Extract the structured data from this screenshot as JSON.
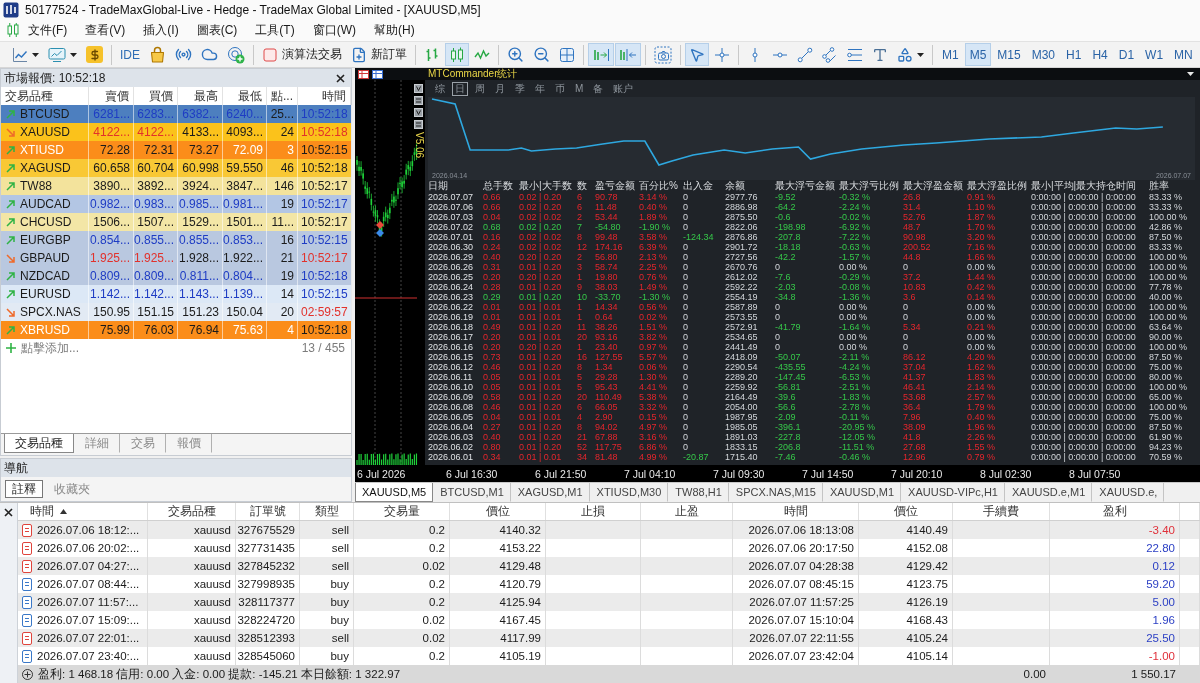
{
  "window": {
    "title": "50177524 - TradeMaxGlobal-Live - Hedge - TradeMax Global Limited - [XAUUSD,M5]"
  },
  "menu": [
    "文件(F)",
    "查看(V)",
    "插入(I)",
    "圖表(C)",
    "工具(T)",
    "窗口(W)",
    "幫助(H)"
  ],
  "toolbar": [
    {
      "kind": "chart-style-menu",
      "selected": false
    },
    {
      "kind": "indicator-menu",
      "selected": false
    },
    {
      "kind": "dollar",
      "selected": false
    },
    {
      "kind": "separator"
    },
    {
      "kind": "ide",
      "label": "IDE",
      "selected": false
    },
    {
      "kind": "market",
      "selected": false
    },
    {
      "kind": "signals",
      "selected": false
    },
    {
      "kind": "cloud",
      "selected": false
    },
    {
      "kind": "vps",
      "selected": false
    },
    {
      "kind": "separator"
    },
    {
      "kind": "algo-trading",
      "label": "演算法交易",
      "selected": false
    },
    {
      "kind": "new-order",
      "label": "新訂單",
      "selected": false
    },
    {
      "kind": "separator"
    },
    {
      "kind": "bar-chart",
      "selected": false
    },
    {
      "kind": "candle-chart",
      "selected": true
    },
    {
      "kind": "line-chart",
      "selected": false
    },
    {
      "kind": "separator"
    },
    {
      "kind": "zoom-in",
      "selected": false
    },
    {
      "kind": "zoom-out",
      "selected": false
    },
    {
      "kind": "tile",
      "selected": false
    },
    {
      "kind": "separator"
    },
    {
      "kind": "auto-scroll",
      "selected": true
    },
    {
      "kind": "chart-shift",
      "selected": true
    },
    {
      "kind": "separator"
    },
    {
      "kind": "screenshot",
      "selected": false
    },
    {
      "kind": "separator"
    },
    {
      "kind": "cursor",
      "selected": true
    },
    {
      "kind": "crosshair",
      "selected": false
    },
    {
      "kind": "separator"
    },
    {
      "kind": "vertical-line",
      "selected": false
    },
    {
      "kind": "horizontal-line",
      "selected": false
    },
    {
      "kind": "trend-line",
      "selected": false
    },
    {
      "kind": "channel",
      "selected": false
    },
    {
      "kind": "fibonacci",
      "selected": false
    },
    {
      "kind": "text",
      "selected": false
    },
    {
      "kind": "shapes-menu",
      "selected": false
    },
    {
      "kind": "separator"
    }
  ],
  "timeframes": [
    {
      "label": "M1",
      "selected": false
    },
    {
      "label": "M5",
      "selected": true
    },
    {
      "label": "M15",
      "selected": false
    },
    {
      "label": "M30",
      "selected": false
    },
    {
      "label": "H1",
      "selected": false
    },
    {
      "label": "H4",
      "selected": false
    },
    {
      "label": "D1",
      "selected": false
    },
    {
      "label": "W1",
      "selected": false
    },
    {
      "label": "MN",
      "selected": false
    }
  ],
  "market_watch": {
    "title": "市場報價: 10:52:18",
    "columns": [
      "交易品種",
      "賣價",
      "買價",
      "最高",
      "最低",
      "點...",
      "時間"
    ],
    "rows": [
      {
        "symbol": "BTCUSD",
        "bid": "6281...",
        "ask": "6283...",
        "high": "6382...",
        "low": "6240...",
        "spread": "25...",
        "time": "10:52:18",
        "kind": "rising",
        "price_up": true,
        "price_down": false,
        "time_up": true,
        "time_down": false,
        "inverted": false,
        "color": "#4d7fbf"
      },
      {
        "symbol": "XAUUSD",
        "bid": "4122...",
        "ask": "4122...",
        "high": "4133...",
        "low": "4093...",
        "spread": "24",
        "time": "10:52:18",
        "kind": "falling",
        "price_up": false,
        "price_down": true,
        "time_up": false,
        "time_down": true,
        "inverted": false,
        "color": "#fbc21b"
      },
      {
        "symbol": "XTIUSD",
        "bid": "72.28",
        "ask": "72.31",
        "high": "73.27",
        "low": "72.09",
        "spread": "3",
        "time": "10:52:15",
        "kind": "rising",
        "price_up": false,
        "price_down": false,
        "time_up": false,
        "time_down": false,
        "inverted": true,
        "color": "#fb8d1a"
      },
      {
        "symbol": "XAGUSD",
        "bid": "60.658",
        "ask": "60.704",
        "high": "60.998",
        "low": "59.550",
        "spread": "46",
        "time": "10:52:18",
        "kind": "rising",
        "price_up": false,
        "price_down": false,
        "time_up": false,
        "time_down": false,
        "inverted": false,
        "color": "#f9c835"
      },
      {
        "symbol": "TW88",
        "bid": "3890...",
        "ask": "3892...",
        "high": "3924...",
        "low": "3847...",
        "spread": "146",
        "time": "10:52:17",
        "kind": "rising",
        "price_up": false,
        "price_down": false,
        "time_up": false,
        "time_down": false,
        "inverted": false,
        "color": "#f3e39c"
      },
      {
        "symbol": "AUDCAD",
        "bid": "0.982...",
        "ask": "0.983...",
        "high": "0.985...",
        "low": "0.981...",
        "spread": "19",
        "time": "10:52:17",
        "kind": "rising",
        "price_up": true,
        "price_down": false,
        "time_up": true,
        "time_down": false,
        "inverted": false,
        "color": "#b3c6e4"
      },
      {
        "symbol": "CHCUSD",
        "bid": "1506...",
        "ask": "1507...",
        "high": "1529...",
        "low": "1501...",
        "spread": "11...",
        "time": "10:52:17",
        "kind": "rising",
        "price_up": false,
        "price_down": false,
        "time_up": false,
        "time_down": false,
        "inverted": false,
        "color": "#f3e6a6"
      },
      {
        "symbol": "EURGBP",
        "bid": "0.854...",
        "ask": "0.855...",
        "high": "0.855...",
        "low": "0.853...",
        "spread": "16",
        "time": "10:52:15",
        "kind": "rising",
        "price_up": true,
        "price_down": false,
        "time_up": true,
        "time_down": false,
        "inverted": false,
        "color": "#b9c8e0"
      },
      {
        "symbol": "GBPAUD",
        "bid": "1.925...",
        "ask": "1.925...",
        "high": "1.928...",
        "low": "1.922...",
        "spread": "21",
        "time": "10:52:17",
        "kind": "falling",
        "price_up": false,
        "price_down": true,
        "time_up": false,
        "time_down": true,
        "inverted": false,
        "color": "#b9c8e0"
      },
      {
        "symbol": "NZDCAD",
        "bid": "0.809...",
        "ask": "0.809...",
        "high": "0.811...",
        "low": "0.804...",
        "spread": "19",
        "time": "10:52:18",
        "kind": "rising",
        "price_up": true,
        "price_down": false,
        "time_up": true,
        "time_down": false,
        "inverted": false,
        "color": "#b9c8e0"
      },
      {
        "symbol": "EURUSD",
        "bid": "1.142...",
        "ask": "1.142...",
        "high": "1.143...",
        "low": "1.139...",
        "spread": "14",
        "time": "10:52:15",
        "kind": "rising",
        "price_up": true,
        "price_down": false,
        "time_up": true,
        "time_down": false,
        "inverted": false,
        "color": "#dce8f6"
      },
      {
        "symbol": "SPCX.NAS",
        "bid": "150.95",
        "ask": "151.15",
        "high": "151.23",
        "low": "150.04",
        "spread": "20",
        "time": "02:59:57",
        "kind": "falling",
        "price_up": false,
        "price_down": false,
        "time_up": false,
        "time_down": true,
        "inverted": false,
        "color": "#e2eaf4"
      },
      {
        "symbol": "XBRUSD",
        "bid": "75.99",
        "ask": "76.03",
        "high": "76.94",
        "low": "75.63",
        "spread": "4",
        "time": "10:52:18",
        "kind": "rising",
        "price_up": false,
        "price_down": false,
        "time_up": false,
        "time_down": false,
        "inverted": true,
        "color": "#fb8d1a"
      }
    ],
    "add_hint": "點擊添加...",
    "count": "13 / 455",
    "tabs": [
      {
        "label": "交易品種",
        "selected": true
      },
      {
        "label": "詳細",
        "selected": false
      },
      {
        "label": "交易",
        "selected": false
      },
      {
        "label": "報價",
        "selected": false
      }
    ]
  },
  "navigator": {
    "title": "導航",
    "tabs": [
      {
        "label": "註釋",
        "selected": true
      },
      {
        "label": "收藏夾",
        "selected": false
      }
    ]
  },
  "chart": {
    "title": "MTCommander统计",
    "version": "V5.06",
    "periods": [
      {
        "label": "综",
        "selected": false
      },
      {
        "label": "日",
        "selected": true
      },
      {
        "label": "周",
        "selected": false
      },
      {
        "label": "月",
        "selected": false
      },
      {
        "label": "季",
        "selected": false
      },
      {
        "label": "年",
        "selected": false
      },
      {
        "label": "币",
        "selected": false
      },
      {
        "label": "M",
        "selected": false
      },
      {
        "label": "备",
        "selected": false
      },
      {
        "label": "账户",
        "selected": false
      }
    ],
    "curve_start": "2026.04.14",
    "curve_end": "2026.07.07",
    "stats_columns": [
      "日期",
      "总手数",
      "最小|大手数",
      "数",
      "盈亏金额",
      "百分比%",
      "出入金",
      "余额",
      "最大浮亏金额",
      "最大浮亏比例",
      "最大浮盈金额",
      "最大浮盈比例",
      "最小|平均|最大持仓时间",
      "胜率"
    ],
    "stats_rows": [
      {
        "date": "2026.07.07",
        "lots": "0.66",
        "min_max": "0.02 | 0.20",
        "trades": "6",
        "pnl": "90.78",
        "pct": "3.14 %",
        "cash_flow": "0",
        "balance": "2977.76",
        "max_float_loss": "-9.52",
        "max_float_loss_pct": "-0.32 %",
        "max_float_profit": "26.8",
        "max_float_profit_pct": "0.91 %",
        "hold_times": "0:00:00 | 0:00:00 | 0:00:00",
        "win_rate": "83.33 %",
        "kind": "gain",
        "floating": true,
        "cash_moved": false
      },
      {
        "date": "2026.07.06",
        "lots": "0.66",
        "min_max": "0.02 | 0.20",
        "trades": "6",
        "pnl": "11.48",
        "pct": "0.40 %",
        "cash_flow": "0",
        "balance": "2886.98",
        "max_float_loss": "-64.2",
        "max_float_loss_pct": "-2.24 %",
        "max_float_profit": "31.4",
        "max_float_profit_pct": "1.10 %",
        "hold_times": "0:00:00 | 0:00:00 | 0:00:00",
        "win_rate": "33.33 %",
        "kind": "gain",
        "floating": true,
        "cash_moved": false
      },
      {
        "date": "2026.07.03",
        "lots": "0.04",
        "min_max": "0.02 | 0.02",
        "trades": "2",
        "pnl": "53.44",
        "pct": "1.89 %",
        "cash_flow": "0",
        "balance": "2875.50",
        "max_float_loss": "-0.6",
        "max_float_loss_pct": "-0.02 %",
        "max_float_profit": "52.76",
        "max_float_profit_pct": "1.87 %",
        "hold_times": "0:00:00 | 0:00:00 | 0:00:00",
        "win_rate": "100.00 %",
        "kind": "gain",
        "floating": true,
        "cash_moved": false
      },
      {
        "date": "2026.07.02",
        "lots": "0.68",
        "min_max": "0.02 | 0.20",
        "trades": "7",
        "pnl": "-54.80",
        "pct": "-1.90 %",
        "cash_flow": "0",
        "balance": "2822.06",
        "max_float_loss": "-198.98",
        "max_float_loss_pct": "-6.92 %",
        "max_float_profit": "48.7",
        "max_float_profit_pct": "1.70 %",
        "hold_times": "0:00:00 | 0:00:00 | 0:00:00",
        "win_rate": "42.86 %",
        "kind": "loss",
        "floating": true,
        "cash_moved": false
      },
      {
        "date": "2026.07.01",
        "lots": "0.16",
        "min_max": "0.02 | 0.02",
        "trades": "8",
        "pnl": "99.48",
        "pct": "3.58 %",
        "cash_flow": "-124.34",
        "balance": "2876.86",
        "max_float_loss": "-207.8",
        "max_float_loss_pct": "-7.22 %",
        "max_float_profit": "90.98",
        "max_float_profit_pct": "3.20 %",
        "hold_times": "0:00:00 | 0:00:00 | 0:00:00",
        "win_rate": "87.50 %",
        "kind": "gain",
        "floating": true,
        "cash_moved": true
      },
      {
        "date": "2026.06.30",
        "lots": "0.24",
        "min_max": "0.02 | 0.02",
        "trades": "12",
        "pnl": "174.16",
        "pct": "6.39 %",
        "cash_flow": "0",
        "balance": "2901.72",
        "max_float_loss": "-18.18",
        "max_float_loss_pct": "-0.63 %",
        "max_float_profit": "200.52",
        "max_float_profit_pct": "7.16 %",
        "hold_times": "0:00:00 | 0:00:00 | 0:00:00",
        "win_rate": "83.33 %",
        "kind": "gain",
        "floating": true,
        "cash_moved": false
      },
      {
        "date": "2026.06.29",
        "lots": "0.40",
        "min_max": "0.20 | 0.20",
        "trades": "2",
        "pnl": "56.80",
        "pct": "2.13 %",
        "cash_flow": "0",
        "balance": "2727.56",
        "max_float_loss": "-42.2",
        "max_float_loss_pct": "-1.57 %",
        "max_float_profit": "44.8",
        "max_float_profit_pct": "1.66 %",
        "hold_times": "0:00:00 | 0:00:00 | 0:00:00",
        "win_rate": "100.00 %",
        "kind": "gain",
        "floating": true,
        "cash_moved": false
      },
      {
        "date": "2026.06.26",
        "lots": "0.31",
        "min_max": "0.01 | 0.20",
        "trades": "3",
        "pnl": "58.74",
        "pct": "2.25 %",
        "cash_flow": "0",
        "balance": "2670.76",
        "max_float_loss": "0",
        "max_float_loss_pct": "0.00 %",
        "max_float_profit": "0",
        "max_float_profit_pct": "0.00 %",
        "hold_times": "0:00:00 | 0:00:00 | 0:00:00",
        "win_rate": "100.00 %",
        "kind": "gain",
        "floating": false,
        "cash_moved": false
      },
      {
        "date": "2026.06.25",
        "lots": "0.20",
        "min_max": "0.20 | 0.20",
        "trades": "1",
        "pnl": "19.80",
        "pct": "0.76 %",
        "cash_flow": "0",
        "balance": "2612.02",
        "max_float_loss": "-7.6",
        "max_float_loss_pct": "-0.29 %",
        "max_float_profit": "37.2",
        "max_float_profit_pct": "1.44 %",
        "hold_times": "0:00:00 | 0:00:00 | 0:00:00",
        "win_rate": "100.00 %",
        "kind": "gain",
        "floating": true,
        "cash_moved": false
      },
      {
        "date": "2026.06.24",
        "lots": "0.28",
        "min_max": "0.01 | 0.20",
        "trades": "9",
        "pnl": "38.03",
        "pct": "1.49 %",
        "cash_flow": "0",
        "balance": "2592.22",
        "max_float_loss": "-2.03",
        "max_float_loss_pct": "-0.08 %",
        "max_float_profit": "10.83",
        "max_float_profit_pct": "0.42 %",
        "hold_times": "0:00:00 | 0:00:00 | 0:00:00",
        "win_rate": "77.78 %",
        "kind": "gain",
        "floating": true,
        "cash_moved": false
      },
      {
        "date": "2026.06.23",
        "lots": "0.29",
        "min_max": "0.01 | 0.20",
        "trades": "10",
        "pnl": "-33.70",
        "pct": "-1.30 %",
        "cash_flow": "0",
        "balance": "2554.19",
        "max_float_loss": "-34.8",
        "max_float_loss_pct": "-1.36 %",
        "max_float_profit": "3.6",
        "max_float_profit_pct": "0.14 %",
        "hold_times": "0:00:00 | 0:00:00 | 0:00:00",
        "win_rate": "40.00 %",
        "kind": "loss",
        "floating": true,
        "cash_moved": false
      },
      {
        "date": "2026.06.22",
        "lots": "0.01",
        "min_max": "0.01 | 0.01",
        "trades": "1",
        "pnl": "14.34",
        "pct": "0.56 %",
        "cash_flow": "0",
        "balance": "2587.89",
        "max_float_loss": "0",
        "max_float_loss_pct": "0.00 %",
        "max_float_profit": "0",
        "max_float_profit_pct": "0.00 %",
        "hold_times": "0:00:00 | 0:00:00 | 0:00:00",
        "win_rate": "100.00 %",
        "kind": "gain",
        "floating": false,
        "cash_moved": false
      },
      {
        "date": "2026.06.19",
        "lots": "0.01",
        "min_max": "0.01 | 0.01",
        "trades": "1",
        "pnl": "0.64",
        "pct": "0.02 %",
        "cash_flow": "0",
        "balance": "2573.55",
        "max_float_loss": "0",
        "max_float_loss_pct": "0.00 %",
        "max_float_profit": "0",
        "max_float_profit_pct": "0.00 %",
        "hold_times": "0:00:00 | 0:00:00 | 0:00:00",
        "win_rate": "100.00 %",
        "kind": "gain",
        "floating": false,
        "cash_moved": false
      },
      {
        "date": "2026.06.18",
        "lots": "0.49",
        "min_max": "0.01 | 0.20",
        "trades": "11",
        "pnl": "38.26",
        "pct": "1.51 %",
        "cash_flow": "0",
        "balance": "2572.91",
        "max_float_loss": "-41.79",
        "max_float_loss_pct": "-1.64 %",
        "max_float_profit": "5.34",
        "max_float_profit_pct": "0.21 %",
        "hold_times": "0:00:00 | 0:00:00 | 0:00:00",
        "win_rate": "63.64 %",
        "kind": "gain",
        "floating": true,
        "cash_moved": false
      },
      {
        "date": "2026.06.17",
        "lots": "0.20",
        "min_max": "0.01 | 0.01",
        "trades": "20",
        "pnl": "93.16",
        "pct": "3.82 %",
        "cash_flow": "0",
        "balance": "2534.65",
        "max_float_loss": "0",
        "max_float_loss_pct": "0.00 %",
        "max_float_profit": "0",
        "max_float_profit_pct": "0.00 %",
        "hold_times": "0:00:00 | 0:00:00 | 0:00:00",
        "win_rate": "90.00 %",
        "kind": "gain",
        "floating": false,
        "cash_moved": false
      },
      {
        "date": "2026.06.16",
        "lots": "0.20",
        "min_max": "0.20 | 0.20",
        "trades": "1",
        "pnl": "23.40",
        "pct": "0.97 %",
        "cash_flow": "0",
        "balance": "2441.49",
        "max_float_loss": "0",
        "max_float_loss_pct": "0.00 %",
        "max_float_profit": "0",
        "max_float_profit_pct": "0.00 %",
        "hold_times": "0:00:00 | 0:00:00 | 0:00:00",
        "win_rate": "100.00 %",
        "kind": "gain",
        "floating": false,
        "cash_moved": false
      },
      {
        "date": "2026.06.15",
        "lots": "0.73",
        "min_max": "0.01 | 0.20",
        "trades": "16",
        "pnl": "127.55",
        "pct": "5.57 %",
        "cash_flow": "0",
        "balance": "2418.09",
        "max_float_loss": "-50.07",
        "max_float_loss_pct": "-2.11 %",
        "max_float_profit": "86.12",
        "max_float_profit_pct": "4.20 %",
        "hold_times": "0:00:00 | 0:00:00 | 0:00:00",
        "win_rate": "87.50 %",
        "kind": "gain",
        "floating": true,
        "cash_moved": false
      },
      {
        "date": "2026.06.12",
        "lots": "0.46",
        "min_max": "0.01 | 0.20",
        "trades": "8",
        "pnl": "1.34",
        "pct": "0.06 %",
        "cash_flow": "0",
        "balance": "2290.54",
        "max_float_loss": "-435.55",
        "max_float_loss_pct": "-4.24 %",
        "max_float_profit": "37.04",
        "max_float_profit_pct": "1.62 %",
        "hold_times": "0:00:00 | 0:00:00 | 0:00:00",
        "win_rate": "75.00 %",
        "kind": "gain",
        "floating": true,
        "cash_moved": false
      },
      {
        "date": "2026.06.11",
        "lots": "0.05",
        "min_max": "0.01 | 0.01",
        "trades": "5",
        "pnl": "29.28",
        "pct": "1.30 %",
        "cash_flow": "0",
        "balance": "2289.20",
        "max_float_loss": "-147.45",
        "max_float_loss_pct": "-6.53 %",
        "max_float_profit": "41.37",
        "max_float_profit_pct": "1.83 %",
        "hold_times": "0:00:00 | 0:00:00 | 0:00:00",
        "win_rate": "80.00 %",
        "kind": "gain",
        "floating": true,
        "cash_moved": false
      },
      {
        "date": "2026.06.10",
        "lots": "0.05",
        "min_max": "0.01 | 0.01",
        "trades": "5",
        "pnl": "95.43",
        "pct": "4.41 %",
        "cash_flow": "0",
        "balance": "2259.92",
        "max_float_loss": "-56.81",
        "max_float_loss_pct": "-2.51 %",
        "max_float_profit": "46.41",
        "max_float_profit_pct": "2.14 %",
        "hold_times": "0:00:00 | 0:00:00 | 0:00:00",
        "win_rate": "100.00 %",
        "kind": "gain",
        "floating": true,
        "cash_moved": false
      },
      {
        "date": "2026.06.09",
        "lots": "0.58",
        "min_max": "0.01 | 0.20",
        "trades": "20",
        "pnl": "110.49",
        "pct": "5.38 %",
        "cash_flow": "0",
        "balance": "2164.49",
        "max_float_loss": "-39.6",
        "max_float_loss_pct": "-1.83 %",
        "max_float_profit": "53.68",
        "max_float_profit_pct": "2.57 %",
        "hold_times": "0:00:00 | 0:00:00 | 0:00:00",
        "win_rate": "65.00 %",
        "kind": "gain",
        "floating": true,
        "cash_moved": false
      },
      {
        "date": "2026.06.08",
        "lots": "0.46",
        "min_max": "0.01 | 0.20",
        "trades": "6",
        "pnl": "66.05",
        "pct": "3.32 %",
        "cash_flow": "0",
        "balance": "2054.00",
        "max_float_loss": "-56.6",
        "max_float_loss_pct": "-2.78 %",
        "max_float_profit": "36.4",
        "max_float_profit_pct": "1.79 %",
        "hold_times": "0:00:00 | 0:00:00 | 0:00:00",
        "win_rate": "100.00 %",
        "kind": "gain",
        "floating": true,
        "cash_moved": false
      },
      {
        "date": "2026.06.05",
        "lots": "0.04",
        "min_max": "0.01 | 0.01",
        "trades": "4",
        "pnl": "2.90",
        "pct": "0.15 %",
        "cash_flow": "0",
        "balance": "1987.95",
        "max_float_loss": "-2.09",
        "max_float_loss_pct": "-0.11 %",
        "max_float_profit": "7.96",
        "max_float_profit_pct": "0.40 %",
        "hold_times": "0:00:00 | 0:00:00 | 0:00:00",
        "win_rate": "75.00 %",
        "kind": "gain",
        "floating": true,
        "cash_moved": false
      },
      {
        "date": "2026.06.04",
        "lots": "0.27",
        "min_max": "0.01 | 0.20",
        "trades": "8",
        "pnl": "94.02",
        "pct": "4.97 %",
        "cash_flow": "0",
        "balance": "1985.05",
        "max_float_loss": "-396.1",
        "max_float_loss_pct": "-20.95 %",
        "max_float_profit": "38.09",
        "max_float_profit_pct": "1.96 %",
        "hold_times": "0:00:00 | 0:00:00 | 0:00:00",
        "win_rate": "87.50 %",
        "kind": "gain",
        "floating": true,
        "cash_moved": false
      },
      {
        "date": "2026.06.03",
        "lots": "0.40",
        "min_max": "0.01 | 0.20",
        "trades": "21",
        "pnl": "67.88",
        "pct": "3.16 %",
        "cash_flow": "0",
        "balance": "1891.03",
        "max_float_loss": "-227.8",
        "max_float_loss_pct": "-12.05 %",
        "max_float_profit": "41.8",
        "max_float_profit_pct": "2.26 %",
        "hold_times": "0:00:00 | 0:00:00 | 0:00:00",
        "win_rate": "61.90 %",
        "kind": "gain",
        "floating": true,
        "cash_moved": false
      },
      {
        "date": "2026.06.02",
        "lots": "0.80",
        "min_max": "0.01 | 0.20",
        "trades": "52",
        "pnl": "117.75",
        "pct": "6.86 %",
        "cash_flow": "0",
        "balance": "1833.15",
        "max_float_loss": "-206.8",
        "max_float_loss_pct": "-11.51 %",
        "max_float_profit": "27.68",
        "max_float_profit_pct": "1.55 %",
        "hold_times": "0:00:00 | 0:00:00 | 0:00:00",
        "win_rate": "94.23 %",
        "kind": "gain",
        "floating": true,
        "cash_moved": false
      },
      {
        "date": "2026.06.01",
        "lots": "0.34",
        "min_max": "0.01 | 0.01",
        "trades": "34",
        "pnl": "81.48",
        "pct": "4.99 %",
        "cash_flow": "-20.87",
        "balance": "1715.40",
        "max_float_loss": "-7.46",
        "max_float_loss_pct": "-0.46 %",
        "max_float_profit": "12.96",
        "max_float_profit_pct": "0.79 %",
        "hold_times": "0:00:00 | 0:00:00 | 0:00:00",
        "win_rate": "70.59 %",
        "kind": "gain",
        "floating": true,
        "cash_moved": true
      }
    ],
    "time_axis": [
      "6 Jul 2026",
      "6 Jul 16:30",
      "6 Jul 21:50",
      "7 Jul 04:10",
      "7 Jul 09:30",
      "7 Jul 14:50",
      "7 Jul 20:10",
      "8 Jul 02:30",
      "8 Jul 07:50"
    ],
    "tabs": [
      {
        "label": "XAUUSD,M5",
        "selected": true
      },
      {
        "label": "BTCUSD,M1",
        "selected": false
      },
      {
        "label": "XAGUSD,M1",
        "selected": false
      },
      {
        "label": "XTIUSD,M30",
        "selected": false
      },
      {
        "label": "TW88,H1",
        "selected": false
      },
      {
        "label": "SPCX.NAS,M15",
        "selected": false
      },
      {
        "label": "XAUUSD,M1",
        "selected": false
      },
      {
        "label": "XAUUSD-VIPc,H1",
        "selected": false
      },
      {
        "label": "XAUUSD.e,M1",
        "selected": false
      },
      {
        "label": "XAUUSD.e,",
        "selected": false
      }
    ]
  },
  "trades": {
    "columns": [
      {
        "label": "時間",
        "sorted": true
      },
      {
        "label": "交易品種",
        "sorted": false
      },
      {
        "label": "訂單號",
        "sorted": false
      },
      {
        "label": "類型",
        "sorted": false
      },
      {
        "label": "交易量",
        "sorted": false
      },
      {
        "label": "價位",
        "sorted": false
      },
      {
        "label": "止損",
        "sorted": false
      },
      {
        "label": "止盈",
        "sorted": false
      },
      {
        "label": "時間",
        "sorted": false
      },
      {
        "label": "價位",
        "sorted": false
      },
      {
        "label": "手續費",
        "sorted": false
      },
      {
        "label": "盈利",
        "sorted": false
      }
    ],
    "rows": [
      {
        "open_time": "2026.07.06 18:12:...",
        "symbol": "xauusd",
        "ticket": "327675529",
        "type": "sell",
        "volume": "0.2",
        "open_price": "4140.32",
        "close_time": "2026.07.06 18:13:08",
        "close_price": "4140.49",
        "profit": "-3.40",
        "kind": "sell",
        "loss": true
      },
      {
        "open_time": "2026.07.06 20:02:...",
        "symbol": "xauusd",
        "ticket": "327731435",
        "type": "sell",
        "volume": "0.2",
        "open_price": "4153.22",
        "close_time": "2026.07.06 20:17:50",
        "close_price": "4152.08",
        "profit": "22.80",
        "kind": "sell",
        "loss": false
      },
      {
        "open_time": "2026.07.07 04:27:...",
        "symbol": "xauusd",
        "ticket": "327845232",
        "type": "sell",
        "volume": "0.02",
        "open_price": "4129.48",
        "close_time": "2026.07.07 04:28:38",
        "close_price": "4129.42",
        "profit": "0.12",
        "kind": "sell",
        "loss": false
      },
      {
        "open_time": "2026.07.07 08:44:...",
        "symbol": "xauusd",
        "ticket": "327998935",
        "type": "buy",
        "volume": "0.2",
        "open_price": "4120.79",
        "close_time": "2026.07.07 08:45:15",
        "close_price": "4123.75",
        "profit": "59.20",
        "kind": "buy",
        "loss": false
      },
      {
        "open_time": "2026.07.07 11:57:...",
        "symbol": "xauusd",
        "ticket": "328117377",
        "type": "buy",
        "volume": "0.2",
        "open_price": "4125.94",
        "close_time": "2026.07.07 11:57:25",
        "close_price": "4126.19",
        "profit": "5.00",
        "kind": "buy",
        "loss": false
      },
      {
        "open_time": "2026.07.07 15:09:...",
        "symbol": "xauusd",
        "ticket": "328224720",
        "type": "buy",
        "volume": "0.02",
        "open_price": "4167.45",
        "close_time": "2026.07.07 15:10:04",
        "close_price": "4168.43",
        "profit": "1.96",
        "kind": "buy",
        "loss": false
      },
      {
        "open_time": "2026.07.07 22:01:...",
        "symbol": "xauusd",
        "ticket": "328512393",
        "type": "sell",
        "volume": "0.02",
        "open_price": "4117.99",
        "close_time": "2026.07.07 22:11:55",
        "close_price": "4105.24",
        "profit": "25.50",
        "kind": "sell",
        "loss": false
      },
      {
        "open_time": "2026.07.07 23:40:...",
        "symbol": "xauusd",
        "ticket": "328545060",
        "type": "buy",
        "volume": "0.2",
        "open_price": "4105.19",
        "close_time": "2026.07.07 23:42:04",
        "close_price": "4105.14",
        "profit": "-1.00",
        "kind": "buy",
        "loss": true
      }
    ],
    "summary": {
      "text": "盈利: 1 468.18 信用: 0.00 入金: 0.00 提款: -145.21 本日餘額: 1 322.97",
      "commission": "0.00",
      "profit": "1 550.17"
    }
  }
}
